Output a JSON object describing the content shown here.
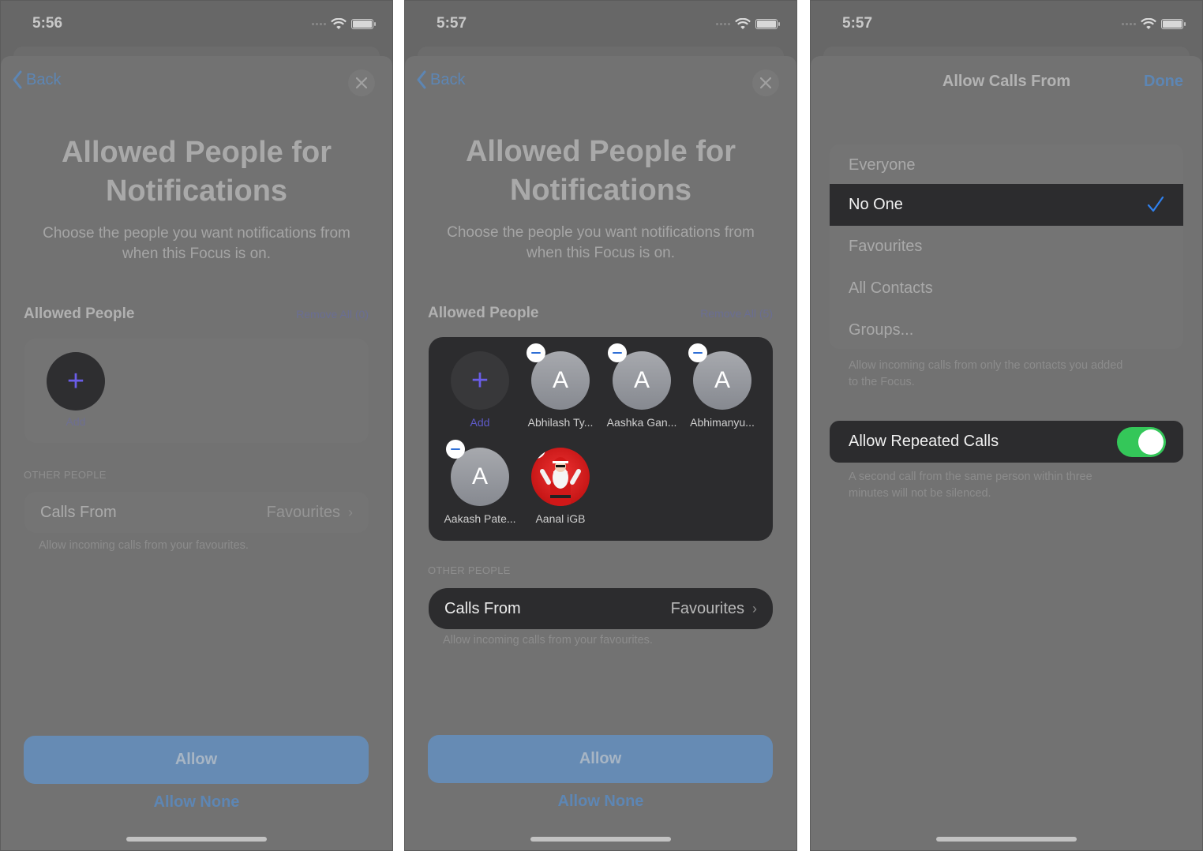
{
  "panels": [
    {
      "status": {
        "time": "5:56"
      },
      "nav": {
        "back_label": "Back",
        "close_icon": "close-icon"
      },
      "title_line1": "Allowed People for",
      "title_line2": "Notifications",
      "subtitle_line1": "Choose the people you want notifications from",
      "subtitle_line2": "when this Focus is on.",
      "allowed_header": "Allowed People",
      "remove_all": "Remove All (0)",
      "add_label": "Add",
      "other_people_label": "OTHER PEOPLE",
      "calls_from": {
        "label": "Calls From",
        "value": "Favourites"
      },
      "calls_footnote": "Allow incoming calls from your favourites.",
      "allow_button": "Allow",
      "allow_none": "Allow None"
    },
    {
      "status": {
        "time": "5:57"
      },
      "nav": {
        "back_label": "Back",
        "close_icon": "close-icon"
      },
      "title_line1": "Allowed People for",
      "title_line2": "Notifications",
      "subtitle_line1": "Choose the people you want notifications from",
      "subtitle_line2": "when this Focus is on.",
      "allowed_header": "Allowed People",
      "remove_all": "Remove All (5)",
      "add_label": "Add",
      "people": [
        {
          "name": "Abhilash Ty...",
          "initial": "A"
        },
        {
          "name": "Aashka Gan...",
          "initial": "A"
        },
        {
          "name": "Abhimanyu...",
          "initial": "A"
        },
        {
          "name": "Aakash Pate...",
          "initial": "A"
        },
        {
          "name": "Aanal iGB",
          "initial": ""
        }
      ],
      "other_people_label": "OTHER PEOPLE",
      "calls_from": {
        "label": "Calls From",
        "value": "Favourites"
      },
      "calls_footnote": "Allow incoming calls from your favourites.",
      "allow_button": "Allow",
      "allow_none": "Allow None"
    },
    {
      "status": {
        "time": "5:57"
      },
      "nav": {
        "title": "Allow Calls From",
        "done": "Done"
      },
      "options": [
        {
          "label": "Everyone",
          "selected": false
        },
        {
          "label": "No One",
          "selected": true
        },
        {
          "label": "Favourites",
          "selected": false
        },
        {
          "label": "All Contacts",
          "selected": false
        },
        {
          "label": "Groups...",
          "selected": false
        }
      ],
      "options_footnote_line1": "Allow incoming calls from only the contacts you added",
      "options_footnote_line2": "to the Focus.",
      "repeated_calls": {
        "label": "Allow Repeated Calls",
        "on": true
      },
      "repeated_footnote_line1": "A second call from the same person within three",
      "repeated_footnote_line2": "minutes will not be silenced."
    }
  ],
  "colors": {
    "accent_blue": "#5d86b4",
    "add_purple": "#6a5de8",
    "toggle_green": "#34c759",
    "check_blue": "#2f80ed",
    "dark_cell": "#2c2c2e"
  }
}
